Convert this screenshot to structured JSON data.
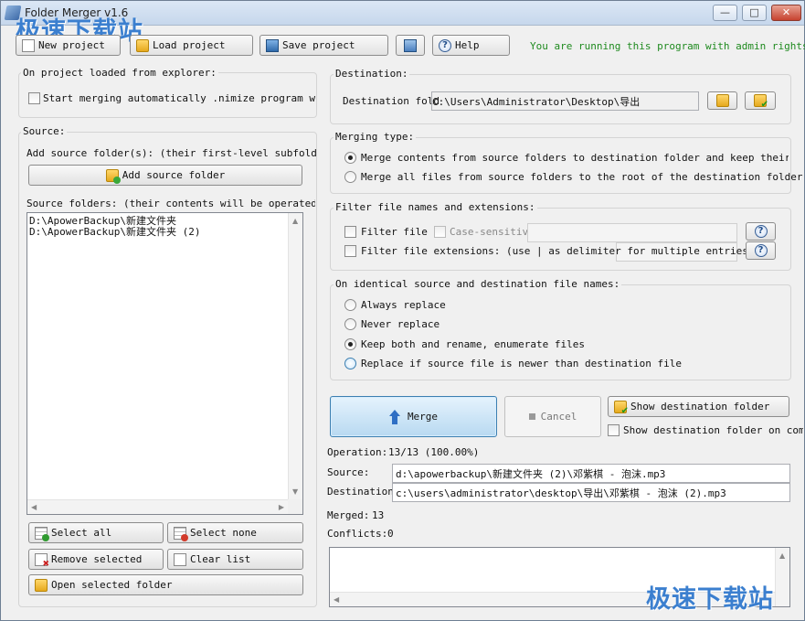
{
  "window": {
    "title": "Folder Merger v1.6",
    "controls": {
      "minimize": "—",
      "maximize": "□",
      "close": "✕"
    },
    "watermark": "极速下载站"
  },
  "toolbar": {
    "new_project": "New project",
    "load_project": "Load project",
    "save_project": "Save project",
    "help": "Help",
    "admin_note": "You are running this program with admin rights."
  },
  "left": {
    "on_load_title": "On project loaded from explorer:",
    "auto_merge_label": "Start merging automatically .nimize program window",
    "source_title": "Source:",
    "add_source_hint": "Add source folder(s): (their first-level subfolders w",
    "add_source_button": "Add source folder",
    "source_folders_label": "Source folders: (their contents will be operated on)",
    "source_folders": [
      "D:\\ApowerBackup\\新建文件夹",
      "D:\\ApowerBackup\\新建文件夹 (2)"
    ],
    "select_all": "Select all",
    "select_none": "Select none",
    "remove_selected": "Remove selected",
    "clear_list": "Clear list",
    "open_selected_folder": "Open selected folder"
  },
  "destination": {
    "title": "Destination:",
    "folder_label": "Destination fold",
    "folder_value": "C:\\Users\\Administrator\\Desktop\\导出"
  },
  "merging_type": {
    "title": "Merging type:",
    "options": [
      "Merge contents from source folders to destination folder and keep their folder",
      "Merge all files from source folders to the root of the destination folder"
    ],
    "selected_index": 0
  },
  "filter": {
    "title": "Filter file names and extensions:",
    "file_names_label": "Filter file n",
    "case_sensitive_label": "Case-sensitive",
    "extensions_label": "Filter file extensions: (use | as delimiter for multiple entries)"
  },
  "identical": {
    "title": "On identical source and destination file names:",
    "options": [
      "Always replace",
      "Never replace",
      "Keep both and rename, enumerate files",
      "Replace if source file is newer than destination file"
    ],
    "selected_index": 2
  },
  "actions": {
    "merge": "Merge",
    "cancel": "Cancel",
    "show_destination": "Show destination folder",
    "show_on_complete": "Show destination folder on comple"
  },
  "status": {
    "operation_label": "Operation:",
    "operation_value": "13/13 (100.00%)",
    "operation_progress": 1.0,
    "source_label": "Source:",
    "source_value": "d:\\apowerbackup\\新建文件夹 (2)\\邓紫棋 - 泡沫.mp3",
    "destination_label": "Destination:",
    "destination_value": "c:\\users\\administrator\\desktop\\导出\\邓紫棋 - 泡沫 (2).mp3",
    "merged_label": "Merged:",
    "merged_value": "13",
    "conflicts_label": "Conflicts:",
    "conflicts_value": "0"
  }
}
